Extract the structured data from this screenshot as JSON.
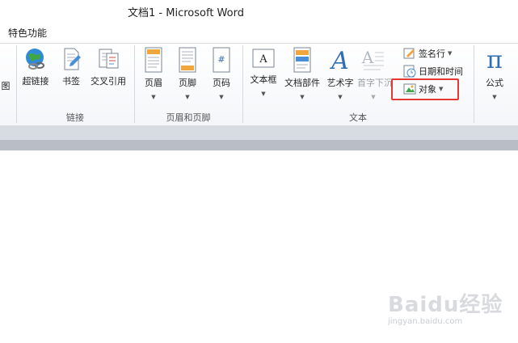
{
  "window": {
    "title": "文档1  -  Microsoft Word"
  },
  "tabs": {
    "special": "特色功能"
  },
  "ribbon": {
    "partial_label": "图",
    "groups": {
      "links": {
        "label": "链接",
        "buttons": {
          "hyperlink": "超链接",
          "bookmark": "书签",
          "cross_reference": "交叉引用"
        }
      },
      "header_footer": {
        "label": "页眉和页脚",
        "buttons": {
          "header": "页眉",
          "footer": "页脚",
          "page_number": "页码"
        }
      },
      "text": {
        "label": "文本",
        "buttons": {
          "text_box": "文本框",
          "quick_parts": "文档部件",
          "wordart": "艺术字",
          "drop_cap": "首字下沉"
        },
        "small": {
          "signature_line": "签名行",
          "date_time": "日期和时间",
          "object": "对象"
        }
      },
      "equation": {
        "label": "公式"
      }
    }
  },
  "watermark": {
    "brand": "Baidu经验",
    "url": "jingyan.baidu.com"
  },
  "colors": {
    "highlight": "#e53935",
    "ribbon_bg": "#f4f6f9"
  }
}
